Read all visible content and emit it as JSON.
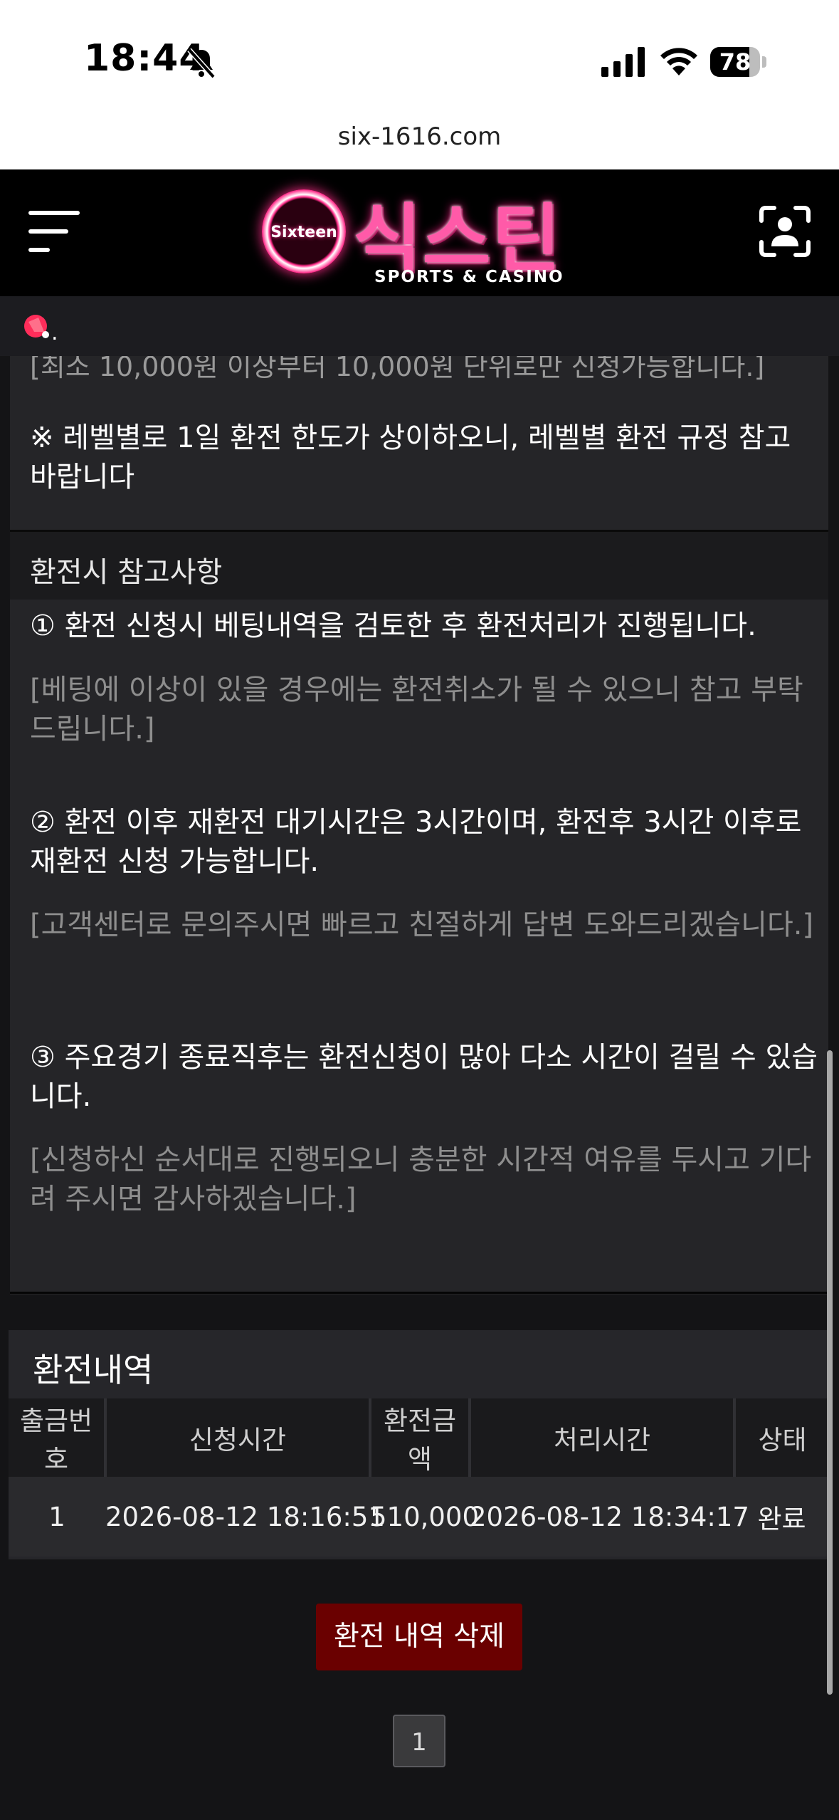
{
  "status_bar": {
    "time": "18:44",
    "battery_percent": 78
  },
  "browser": {
    "url": "six-1616.com"
  },
  "header": {
    "logo_badge": "Sixteen",
    "logo_main": "식스틴",
    "logo_sub": "SPORTS & CASINO"
  },
  "notice_bar": {
    "text": "."
  },
  "content": {
    "cut_off_line": "[최소 10,000원 이상부터 10,000원 단위로만 신청가능합니다.]",
    "level_note": "※ 레벨별로 1일 환전 한도가 상이하오니, 레벨별 환전 규정 참고바랍니다",
    "reference_title": "환전시 참고사항",
    "items": [
      {
        "title": "① 환전 신청시 베팅내역을 검토한 후 환전처리가 진행됩니다.",
        "desc": "[베팅에 이상이 있을 경우에는 환전취소가 될 수 있으니 참고 부탁드립니다.]"
      },
      {
        "title": "② 환전 이후 재환전 대기시간은 3시간이며, 환전후 3시간 이후로 재환전 신청 가능합니다.",
        "desc": "[고객센터로 문의주시면 빠르고 친절하게 답변 도와드리겠습니다.]"
      },
      {
        "title": "③ 주요경기 종료직후는 환전신청이 많아 다소 시간이 걸릴 수 있습니다.",
        "desc": "[신청하신 순서대로 진행되오니 충분한 시간적 여유를 두시고 기다려 주시면 감사하겠습니다.]"
      }
    ]
  },
  "history": {
    "title": "환전내역",
    "columns": [
      "출금번호",
      "신청시간",
      "환전금액",
      "처리시간",
      "상태"
    ],
    "rows": [
      [
        "1",
        "2026-08-12 18:16:51",
        "510,000",
        "2026-08-12 18:34:17",
        "완료"
      ]
    ],
    "delete_label": "환전 내역 삭제",
    "current_page": "1"
  },
  "colors": {
    "background": "#141416",
    "panel": "#252528",
    "accent_pink": "#ff2d8a",
    "delete_button": "#6a0000"
  },
  "icons": {
    "menu": "hamburger-icon",
    "profile": "profile-scan-icon",
    "notice": "megaphone-icon",
    "silent": "bell-slash-icon",
    "signal": "cellular-signal-icon",
    "wifi": "wifi-icon",
    "battery": "battery-icon"
  }
}
